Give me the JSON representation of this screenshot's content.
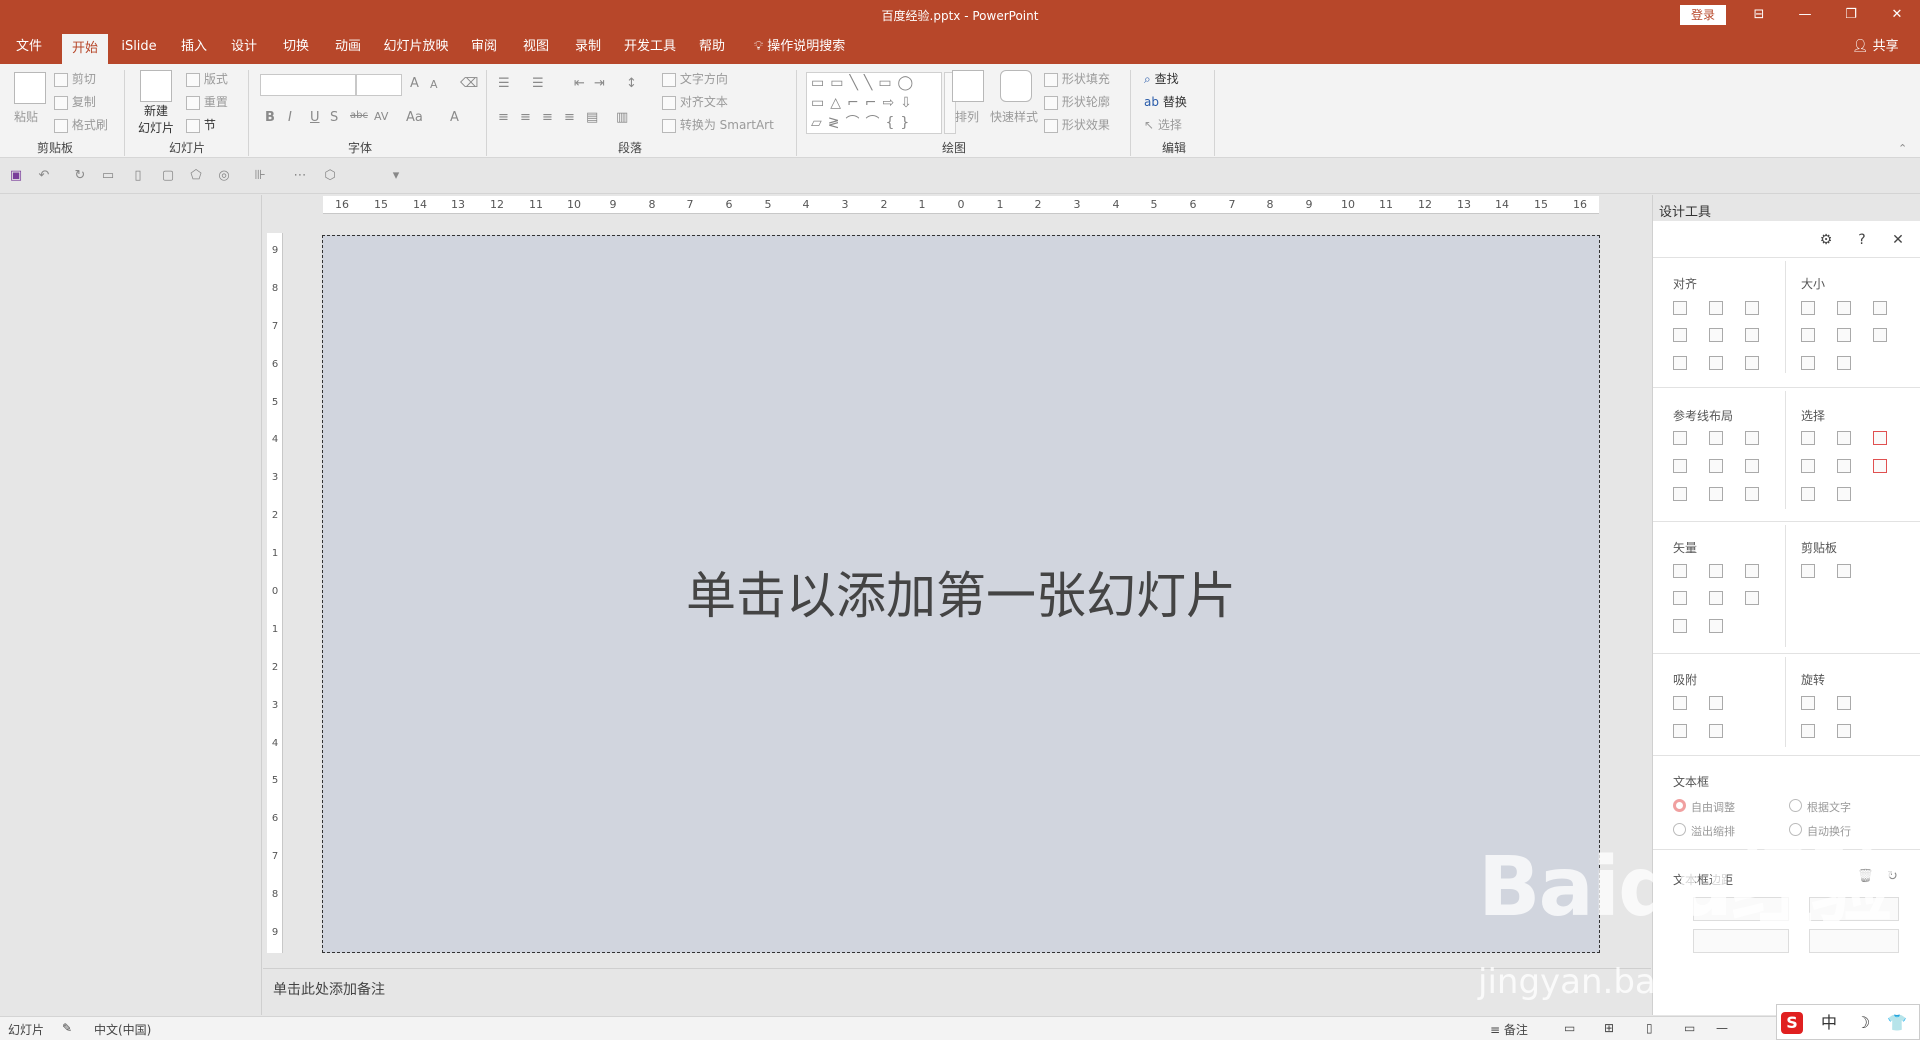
{
  "window": {
    "title": "百度经验.pptx  -  PowerPoint",
    "login_label": "登录",
    "controls": [
      "⊟",
      "—",
      "❐",
      "✕"
    ]
  },
  "tabs": [
    {
      "label": "文件",
      "active": false
    },
    {
      "label": "开始",
      "active": true
    },
    {
      "label": "iSlide",
      "active": false
    },
    {
      "label": "插入",
      "active": false
    },
    {
      "label": "设计",
      "active": false
    },
    {
      "label": "切换",
      "active": false
    },
    {
      "label": "动画",
      "active": false
    },
    {
      "label": "幻灯片放映",
      "active": false
    },
    {
      "label": "审阅",
      "active": false
    },
    {
      "label": "视图",
      "active": false
    },
    {
      "label": "录制",
      "active": false
    },
    {
      "label": "开发工具",
      "active": false
    },
    {
      "label": "帮助",
      "active": false
    }
  ],
  "tell_me": "操作说明搜索",
  "share_label": "共享",
  "ribbon": {
    "clipboard": {
      "label": "剪贴板",
      "paste": "粘贴",
      "cut": "剪切",
      "copy": "复制",
      "format_painter": "格式刷"
    },
    "slides": {
      "label": "幻灯片",
      "new_slide_1": "新建",
      "new_slide_2": "幻灯片",
      "layout": "版式",
      "reset": "重置",
      "section": "节"
    },
    "font": {
      "label": "字体",
      "bold": "B",
      "italic": "I",
      "underline": "U",
      "shadow": "S",
      "strike": "abc",
      "spacing": "AV",
      "case": "Aa",
      "color": "A",
      "grow": "A",
      "shrink": "A"
    },
    "paragraph": {
      "label": "段落",
      "text_direction": "文字方向",
      "align_text": "对齐文本",
      "smartart": "转换为 SmartArt"
    },
    "drawing": {
      "label": "绘图",
      "arrange": "排列",
      "quick_styles": "快速样式",
      "shape_fill": "形状填充",
      "shape_outline": "形状轮廓",
      "shape_effects": "形状效果"
    },
    "editing": {
      "label": "编辑",
      "find": "查找",
      "replace": "替换",
      "select": "选择"
    }
  },
  "ruler": {
    "h_ticks": [
      "16",
      "15",
      "14",
      "13",
      "12",
      "11",
      "10",
      "9",
      "8",
      "7",
      "6",
      "5",
      "4",
      "3",
      "2",
      "1",
      "0",
      "1",
      "2",
      "3",
      "4",
      "5",
      "6",
      "7",
      "8",
      "9",
      "10",
      "11",
      "12",
      "13",
      "14",
      "15",
      "16"
    ],
    "v_ticks": [
      "9",
      "8",
      "7",
      "6",
      "5",
      "4",
      "3",
      "2",
      "1",
      "0",
      "1",
      "2",
      "3",
      "4",
      "5",
      "6",
      "7",
      "8",
      "9"
    ]
  },
  "slide": {
    "placeholder": "单击以添加第一张幻灯片"
  },
  "notes": {
    "placeholder": "单击此处添加备注"
  },
  "design_panel": {
    "title": "设计工具",
    "sections": {
      "align": "对齐",
      "size": "大小",
      "guides": "参考线布局",
      "select": "选择",
      "vector": "矢量",
      "clipboard": "剪贴板",
      "snap": "吸附",
      "rotate": "旋转",
      "textbox": "文本框",
      "margins": "文本框边距"
    },
    "textbox_options": [
      "自由调整",
      "根据文字",
      "溢出缩排",
      "自动换行"
    ]
  },
  "statusbar": {
    "slide_label": "幻灯片",
    "language": "中文(中国)",
    "notes_label": "备注"
  },
  "watermark": {
    "main": "Baidu经验",
    "sub": "jingyan.baidu.com"
  },
  "ime": [
    "S",
    "中",
    "☽",
    "👕"
  ]
}
